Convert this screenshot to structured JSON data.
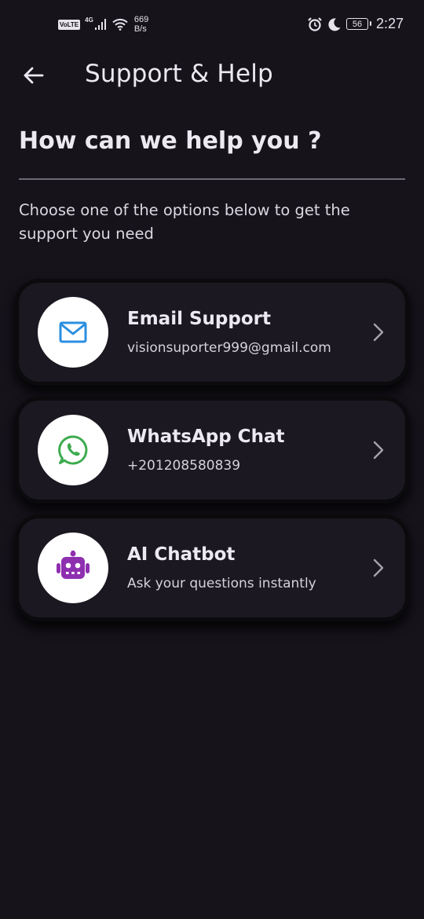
{
  "status_bar": {
    "volte": "VoLTE",
    "network_type": "4G",
    "speed_value": "669",
    "speed_unit": "B/s",
    "battery": "56",
    "time": "2:27"
  },
  "app_bar": {
    "title": "Support & Help",
    "back_icon": "arrow-left-icon"
  },
  "content": {
    "heading": "How can we help you ?",
    "subtitle": "Choose one of the options below to get the support you need"
  },
  "options": [
    {
      "title": "Email Support",
      "subtitle": "visionsuporter999@gmail.com",
      "icon": "mail-icon",
      "icon_color": "#2b8fe0"
    },
    {
      "title": "WhatsApp Chat",
      "subtitle": "+201208580839",
      "icon": "whatsapp-icon",
      "icon_color": "#3dab4f"
    },
    {
      "title": "AI Chatbot",
      "subtitle": "Ask your questions instantly",
      "icon": "robot-icon",
      "icon_color": "#8e2fb0"
    }
  ],
  "colors": {
    "background": "#16131b",
    "card": "#1b1821",
    "text": "#ece9f0",
    "divider": "#6e6a74"
  }
}
